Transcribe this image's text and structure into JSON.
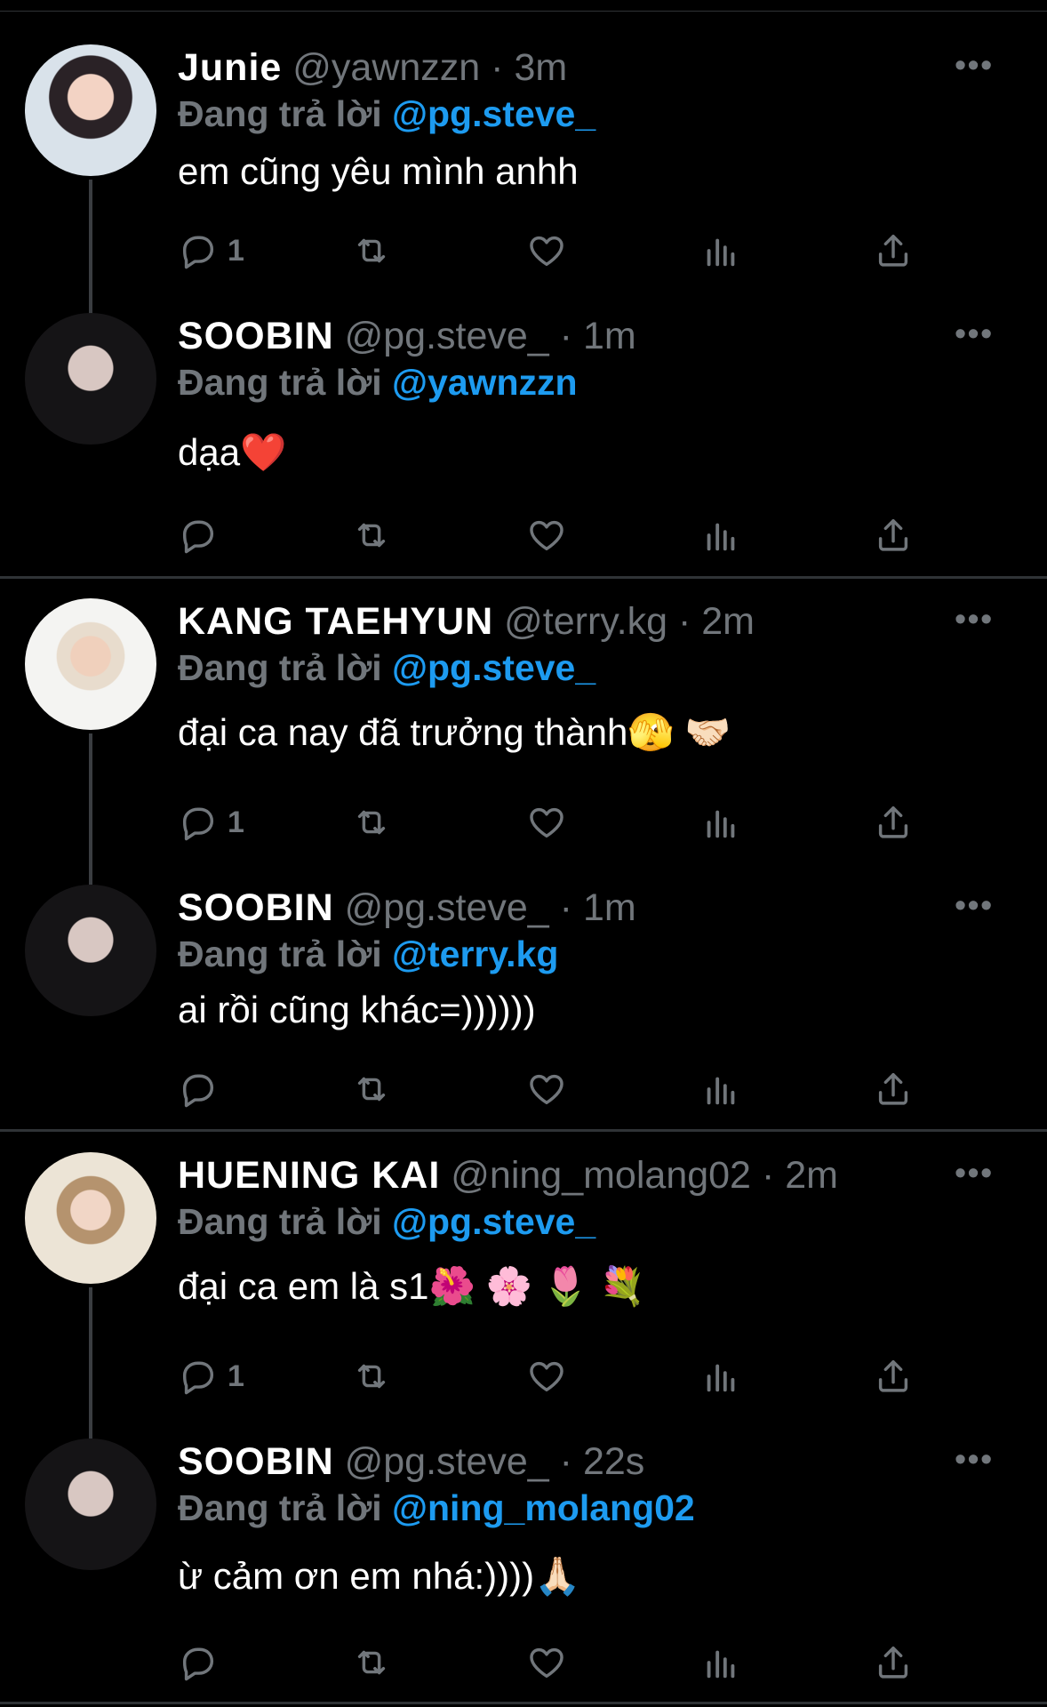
{
  "tweets": [
    {
      "name": "Junie",
      "handle": "@yawnzzn",
      "dot": "·",
      "time": "3m",
      "replying_label": "Đang trả lời",
      "mention": "@pg.steve_",
      "text": "em cũng yêu mình anhh",
      "reply_count": "1"
    },
    {
      "name": "SOOBIN",
      "handle": "@pg.steve_",
      "dot": "·",
      "time": "1m",
      "replying_label": "Đang trả lời",
      "mention": "@yawnzzn",
      "text": "dạa❤️",
      "reply_count": ""
    },
    {
      "name": "KANG TAEHYUN",
      "handle": "@terry.kg",
      "dot": "·",
      "time": "2m",
      "replying_label": "Đang trả lời",
      "mention": "@pg.steve_",
      "text": "đại ca nay đã trưởng thành🫣 🤝🏻",
      "reply_count": "1"
    },
    {
      "name": "SOOBIN",
      "handle": "@pg.steve_",
      "dot": "·",
      "time": "1m",
      "replying_label": "Đang trả lời",
      "mention": "@terry.kg",
      "text": "ai rồi cũng khác=))))))",
      "reply_count": ""
    },
    {
      "name": "HUENING KAI",
      "handle": "@ning_molang02",
      "dot": "·",
      "time": "2m",
      "replying_label": "Đang trả lời",
      "mention": "@pg.steve_",
      "text": "đại ca em là s1🌺 🌸 🌷 💐",
      "reply_count": "1"
    },
    {
      "name": "SOOBIN",
      "handle": "@pg.steve_",
      "dot": "·",
      "time": "22s",
      "replying_label": "Đang trả lời",
      "mention": "@ning_molang02",
      "text": "ừ cảm ơn em nhá:))))🙏🏻",
      "reply_count": ""
    }
  ],
  "more_icon": "•••",
  "colors": {
    "background": "#000000",
    "muted": "#71767b",
    "accent": "#1d9bf0",
    "divider": "#2f3336"
  }
}
